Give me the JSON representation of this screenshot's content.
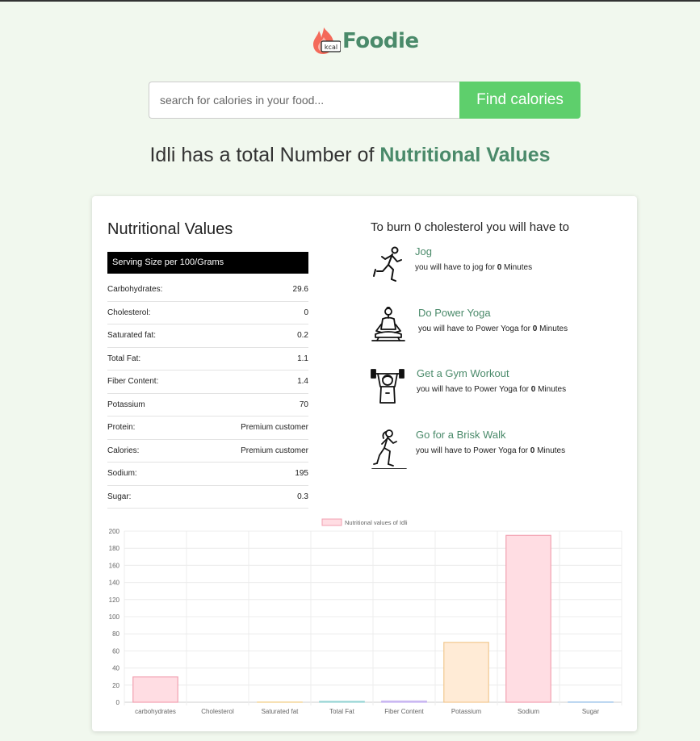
{
  "brand": {
    "name": "Foodie",
    "badge": "kcal"
  },
  "search": {
    "placeholder": "search for calories in your food...",
    "button": "Find calories"
  },
  "headline": {
    "prefix": "Idli has a total Number of ",
    "highlight": "Nutritional Values"
  },
  "nutrition": {
    "title": "Nutritional Values",
    "serving": "Serving Size per 100/Grams",
    "rows": [
      {
        "label": "Carbohydrates:",
        "value": "29.6"
      },
      {
        "label": "Cholesterol:",
        "value": "0"
      },
      {
        "label": "Saturated fat:",
        "value": "0.2"
      },
      {
        "label": "Total Fat:",
        "value": "1.1"
      },
      {
        "label": "Fiber Content:",
        "value": "1.4"
      },
      {
        "label": "Potassium",
        "value": "70"
      },
      {
        "label": "Protein:",
        "value": "Premium customer"
      },
      {
        "label": "Calories:",
        "value": "Premium customer"
      },
      {
        "label": "Sodium:",
        "value": "195"
      },
      {
        "label": "Sugar:",
        "value": "0.3"
      }
    ]
  },
  "burn": {
    "title": "To burn 0 cholesterol you will have to",
    "activities": [
      {
        "name": "Jog",
        "desc_pre": "you will have to jog for ",
        "amount": "0",
        "desc_post": " Minutes",
        "icon": "jogging-icon"
      },
      {
        "name": "Do Power Yoga",
        "desc_pre": "you will have to Power Yoga for ",
        "amount": "0",
        "desc_post": " Minutes",
        "icon": "yoga-icon"
      },
      {
        "name": "Get a Gym Workout",
        "desc_pre": "you will have to Power Yoga for ",
        "amount": "0",
        "desc_post": " Minutes",
        "icon": "weightlifting-icon"
      },
      {
        "name": "Go for a Brisk Walk",
        "desc_pre": "you will have to Power Yoga for ",
        "amount": "0",
        "desc_post": " Minutes",
        "icon": "walking-icon"
      }
    ]
  },
  "colors": {
    "accent": "#4a8a6a",
    "button": "#5ecf6c",
    "background": "#f1f8ee"
  },
  "chart_data": {
    "type": "bar",
    "legend": "Nutritional values of Idli",
    "legend_position": "top",
    "categories": [
      "carbohydrates",
      "Cholesterol",
      "Saturated fat",
      "Total Fat",
      "Fiber Content",
      "Potassium",
      "Sodium",
      "Sugar"
    ],
    "values": [
      29.6,
      0,
      0.2,
      1.1,
      1.4,
      70,
      195,
      0.3
    ],
    "bar_colors": [
      "#ffdde3",
      "#dbeafb",
      "#fff3d6",
      "#ddf2f2",
      "#ebe3ff",
      "#ffebd6",
      "#ffdde3",
      "#dbeafb"
    ],
    "border_colors": [
      "#f2a0b0",
      "#9cc4ea",
      "#f2d08a",
      "#9ad6d6",
      "#c4b0f0",
      "#f2c890",
      "#f2a0b0",
      "#9cc4ea"
    ],
    "ylim": [
      0,
      200
    ],
    "yticks": [
      0,
      20,
      40,
      60,
      80,
      100,
      120,
      140,
      160,
      180,
      200
    ],
    "grid": true
  }
}
